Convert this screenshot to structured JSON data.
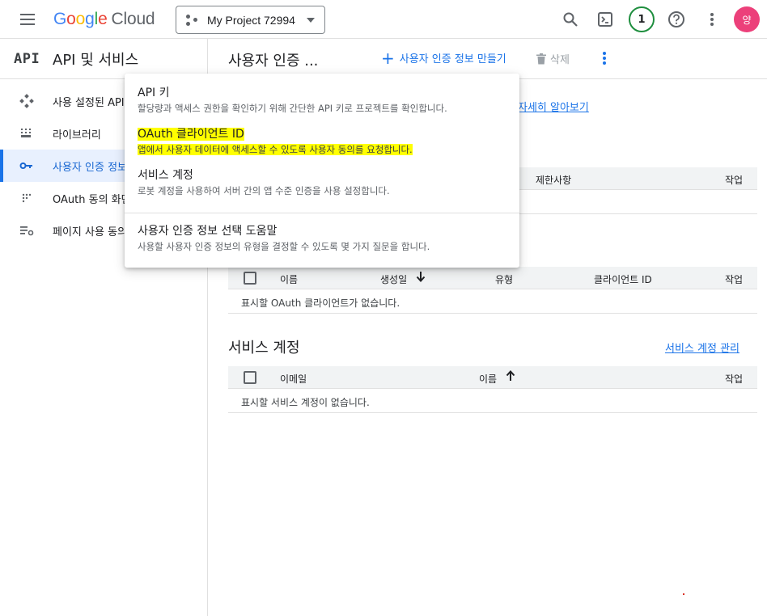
{
  "topbar": {
    "logo": {
      "g": "G",
      "o1": "o",
      "o2": "o",
      "g2": "g",
      "l": "l",
      "e": "e",
      "cloud": "Cloud"
    },
    "project_label": "My Project 72994",
    "notification_count": "1",
    "avatar_initial": "양"
  },
  "sidebar": {
    "badge": "API",
    "title": "API 및 서비스",
    "items": [
      {
        "label": "사용 설정된 API 및 서비스",
        "icon": "diamond-nodes-icon"
      },
      {
        "label": "라이브러리",
        "icon": "library-grid-icon"
      },
      {
        "label": "사용자 인증 정보",
        "icon": "key-icon"
      },
      {
        "label": "OAuth 동의 화면",
        "icon": "dots-grid-icon"
      },
      {
        "label": "페이지 사용 동의",
        "icon": "settings-list-icon"
      }
    ]
  },
  "header": {
    "title": "사용자 인증 ...",
    "create_label": "사용자 인증 정보 만들기",
    "delete_label": "삭제"
  },
  "main": {
    "learn_more": "자세히 알아보기",
    "api_keys_table": {
      "col_restrictions": "제한사항",
      "col_actions": "작업"
    },
    "oauth_table": {
      "col_name": "이름",
      "col_created": "생성일",
      "col_type": "유형",
      "col_client_id": "클라이언트 ID",
      "col_actions": "작업",
      "empty": "표시할 OAuth 클라이언트가 없습니다."
    },
    "service_accounts": {
      "title": "서비스 계정",
      "manage_link": "서비스 계정 관리",
      "col_email": "이메일",
      "col_name": "이름",
      "col_actions": "작업",
      "empty": "표시할 서비스 계정이 없습니다."
    }
  },
  "dropdown": {
    "items": [
      {
        "title": "API 키",
        "desc": "할당량과 액세스 권한을 확인하기 위해 간단한 API 키로 프로젝트를 확인합니다."
      },
      {
        "title": "OAuth 클라이언트 ID",
        "desc": "앱에서 사용자 데이터에 액세스할 수 있도록 사용자 동의를 요청합니다."
      },
      {
        "title": "서비스 계정",
        "desc": "로봇 계정을 사용하여 서버 간의 앱 수준 인증을 사용 설정합니다."
      },
      {
        "title": "사용자 인증 정보 선택 도움말",
        "desc": "사용할 사용자 인증 정보의 유형을 결정할 수 있도록 몇 가지 질문을 합니다."
      }
    ]
  },
  "colors": {
    "accent": "#1a73e8",
    "highlight": "#ffff00",
    "avatar_bg": "#ec407a",
    "badge_border": "#1e8e3e"
  }
}
